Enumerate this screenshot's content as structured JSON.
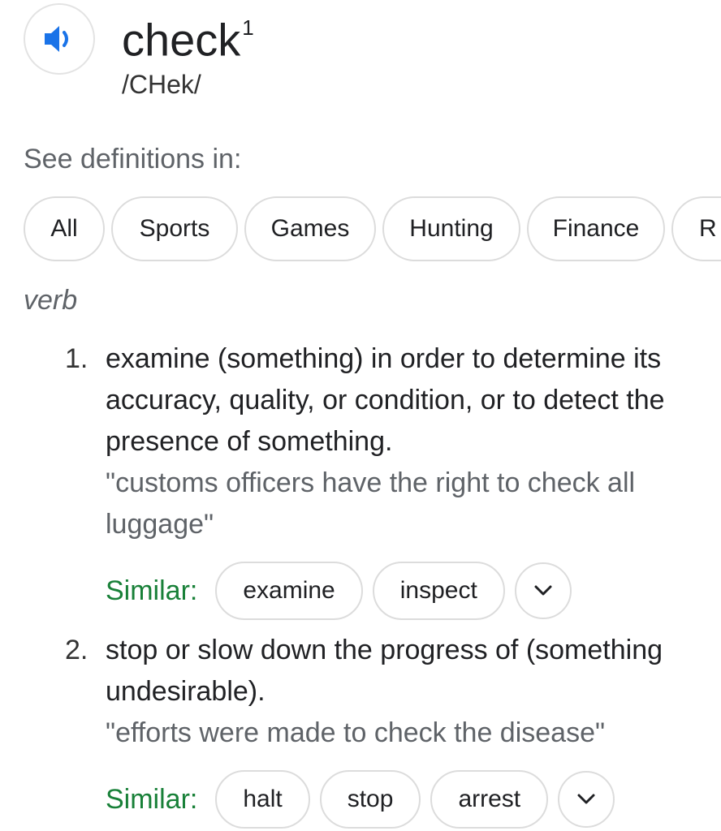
{
  "entry": {
    "word": "check",
    "superscript": "1",
    "phonetic": "/CHek/"
  },
  "see_definitions_label": "See definitions in:",
  "categories": [
    "All",
    "Sports",
    "Games",
    "Hunting",
    "Finance",
    "R"
  ],
  "part_of_speech": "verb",
  "definitions": [
    {
      "number": "1.",
      "text": "examine (something) in order to determine its accuracy, quality, or condition, or to detect the presence of something.",
      "example": "\"customs officers have the right to check all luggage\"",
      "similar_label": "Similar:",
      "synonyms": [
        "examine",
        "inspect"
      ]
    },
    {
      "number": "2.",
      "text": "stop or slow down the progress of (something undesirable).",
      "example": "\"efforts were made to check the disease\"",
      "similar_label": "Similar:",
      "synonyms": [
        "halt",
        "stop",
        "arrest"
      ]
    }
  ],
  "icons": {
    "speaker": "speaker-icon",
    "expand": "chevron-down-icon"
  },
  "colors": {
    "accent_blue": "#1a73e8",
    "similar_green": "#188038",
    "chip_border": "#dcdcdc",
    "muted_text": "#5f6368"
  }
}
